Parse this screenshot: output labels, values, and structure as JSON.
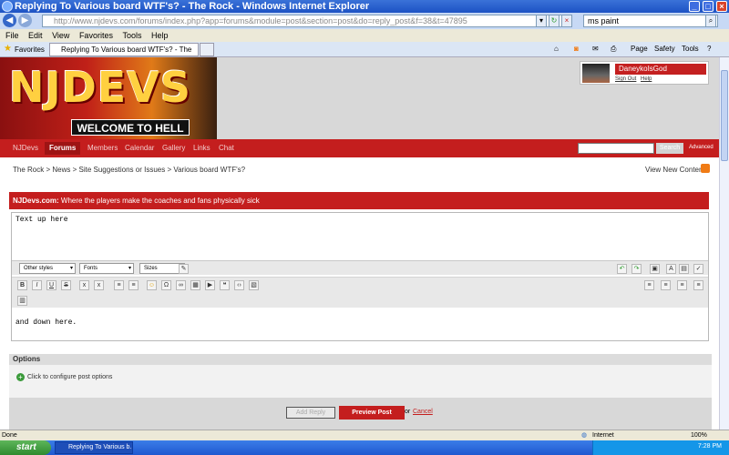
{
  "window": {
    "title": "Replying To Various board WTF's? - The Rock - Windows Internet Explorer",
    "address": "http://www.njdevs.com/forums/index.php?app=forums&module=post&section=post&do=reply_post&f=38&t=47895",
    "search_value": "ms paint",
    "tab_title": "Replying To Various board WTF's? - The Rock",
    "menu": [
      "File",
      "Edit",
      "View",
      "Favorites",
      "Tools",
      "Help"
    ],
    "favorites_label": "Favorites",
    "toolbar": {
      "page": "Page",
      "safety": "Safety",
      "tools": "Tools"
    }
  },
  "site": {
    "logo_text": "NJDEVS",
    "logo_subtitle": "WELCOME TO HELL",
    "user": {
      "name": "DaneykoIsGod",
      "sign_out": "Sign Out",
      "help": "Help"
    },
    "nav": [
      "NJDevs",
      "Forums",
      "Members",
      "Calendar",
      "Gallery",
      "Links",
      "Chat"
    ],
    "search_button": "Search",
    "advanced": "Advanced"
  },
  "breadcrumb": [
    "The Rock",
    "News",
    "Site Suggestions or Issues",
    "Various board WTF's?"
  ],
  "view_new_content": "View New Content",
  "announcement": {
    "site": "NJDevs.com:",
    "text": "Where the players make the coaches and fans physically sick"
  },
  "editor": {
    "top_text": "Text up here",
    "bottom_text": "and down here.",
    "selects": [
      "Other styles",
      "Fonts",
      "Sizes"
    ]
  },
  "options": {
    "header": "Options",
    "configure": "Click to configure post options"
  },
  "actions": {
    "add_reply": "Add Reply",
    "preview": "Preview Post",
    "or": "or",
    "cancel": "Cancel"
  },
  "status": {
    "left": "Done",
    "zone": "Internet",
    "zoom": "100%"
  },
  "taskbar": {
    "start": "start",
    "item": "Replying To Various b...",
    "clock": "7:28 PM"
  }
}
